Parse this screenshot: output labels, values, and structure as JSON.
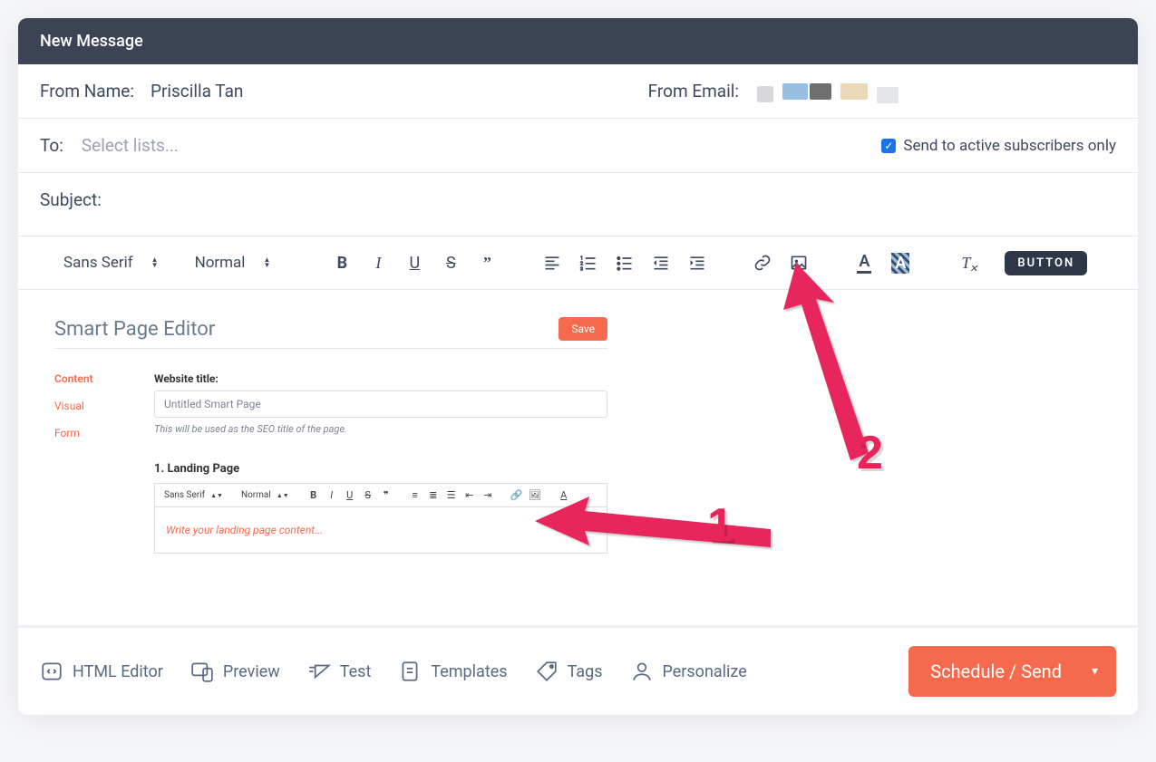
{
  "window": {
    "title": "New Message"
  },
  "from": {
    "name_label": "From Name:",
    "name_value": "Priscilla Tan",
    "email_label": "From Email:"
  },
  "to": {
    "label": "To:",
    "placeholder": "Select lists..."
  },
  "active_sub": {
    "label": "Send to active subscribers only",
    "checked": true
  },
  "subject": {
    "label": "Subject:"
  },
  "toolbar": {
    "font": "Sans Serif",
    "size": "Normal",
    "button_label": "BUTTON"
  },
  "inner": {
    "title": "Smart Page Editor",
    "save": "Save",
    "side": {
      "content": "Content",
      "visual": "Visual",
      "form": "Form"
    },
    "field_label": "Website title:",
    "field_value": "Untitled Smart Page",
    "hint": "This will be used as the SEO title of the page.",
    "section": "1. Landing Page",
    "mini_font": "Sans Serif",
    "mini_size": "Normal",
    "body_placeholder": "Write your landing page content..."
  },
  "annotations": {
    "one": "1",
    "two": "2"
  },
  "footer": {
    "html_editor": "HTML Editor",
    "preview": "Preview",
    "test": "Test",
    "templates": "Templates",
    "tags": "Tags",
    "personalize": "Personalize",
    "schedule": "Schedule / Send"
  }
}
